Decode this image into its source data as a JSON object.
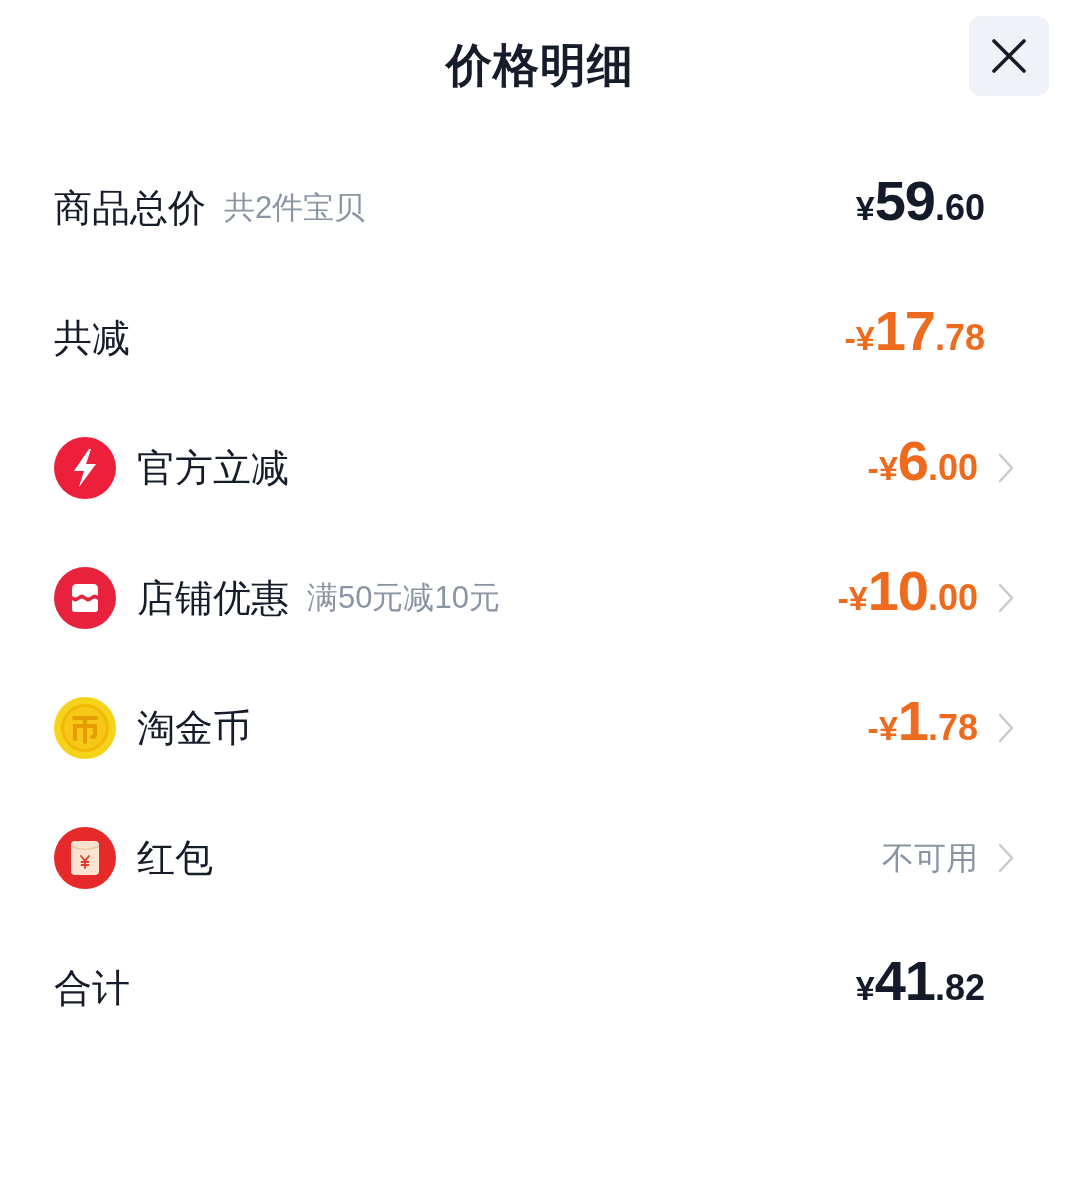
{
  "header": {
    "title": "价格明细"
  },
  "rows": [
    {
      "kind": "subtotal",
      "label": "商品总价",
      "note": "共2件宝贝",
      "amount": {
        "prefix": "¥",
        "integer": "59",
        "decimal": ".60"
      }
    },
    {
      "kind": "total-discount",
      "label": "共减",
      "amount": {
        "prefix": "-¥",
        "integer": "17",
        "decimal": ".78"
      }
    },
    {
      "kind": "official-discount",
      "label": "官方立减",
      "amount": {
        "prefix": "-¥",
        "integer": "6",
        "decimal": ".00"
      }
    },
    {
      "kind": "shop-discount",
      "label": "店铺优惠",
      "note": "满50元减10元",
      "amount": {
        "prefix": "-¥",
        "integer": "10",
        "decimal": ".00"
      }
    },
    {
      "kind": "coins",
      "label": "淘金币",
      "amount": {
        "prefix": "-¥",
        "integer": "1",
        "decimal": ".78"
      }
    },
    {
      "kind": "red-packet",
      "label": "红包",
      "status": "不可用"
    },
    {
      "kind": "total",
      "label": "合计",
      "amount": {
        "prefix": "¥",
        "integer": "41",
        "decimal": ".82"
      }
    }
  ]
}
